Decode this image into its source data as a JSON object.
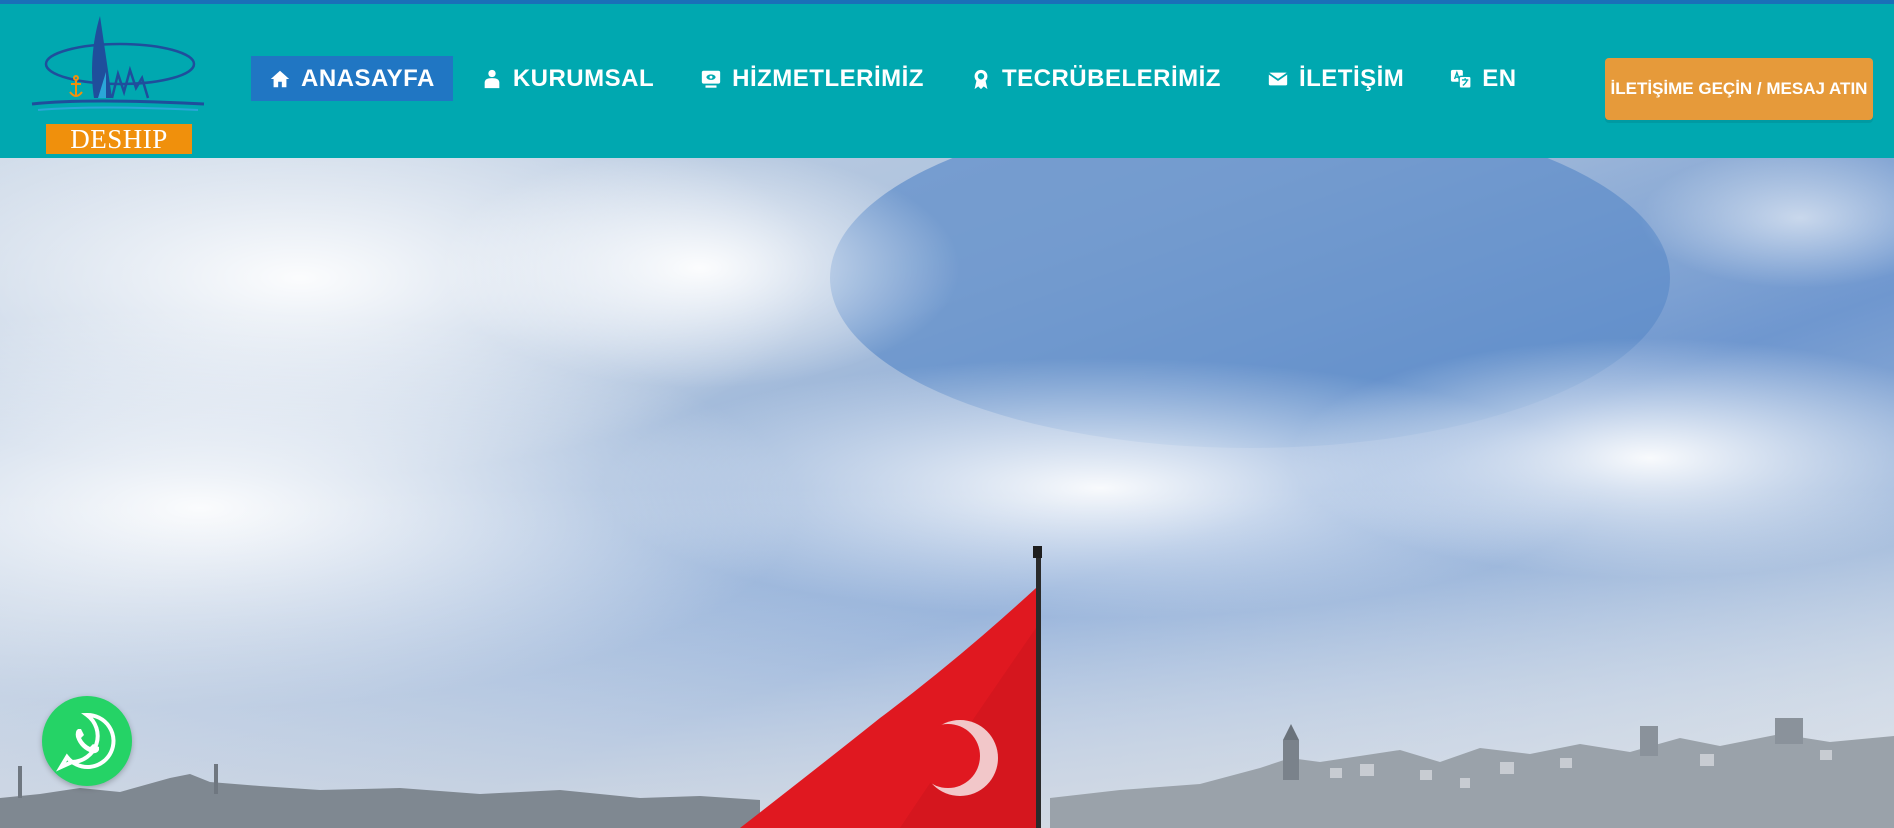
{
  "brand": {
    "name": "DESHIP",
    "colors": {
      "header": "#00a8b0",
      "topline": "#1a6fb8",
      "active_nav": "#2076c3",
      "cta": "#e69a3a",
      "logo_box": "#f0900c",
      "whatsapp": "#25d366"
    }
  },
  "nav": {
    "items": [
      {
        "label": "ANASAYFA",
        "icon": "home-icon",
        "active": true
      },
      {
        "label": "KURUMSAL",
        "icon": "user-icon",
        "active": false
      },
      {
        "label": "HİZMETLERİMİZ",
        "icon": "monitor-icon",
        "active": false
      },
      {
        "label": "TECRÜBELERİMİZ",
        "icon": "award-icon",
        "active": false
      },
      {
        "label": "İLETİŞİM",
        "icon": "mail-icon",
        "active": false
      },
      {
        "label": "EN",
        "icon": "translate-icon",
        "active": false
      }
    ]
  },
  "cta": {
    "label": "İLETİŞİME GEÇİN / MESAJ ATIN"
  },
  "hero": {
    "image": "istanbul-skyline-with-turkish-flag"
  },
  "floating": {
    "icon": "whatsapp-icon"
  }
}
